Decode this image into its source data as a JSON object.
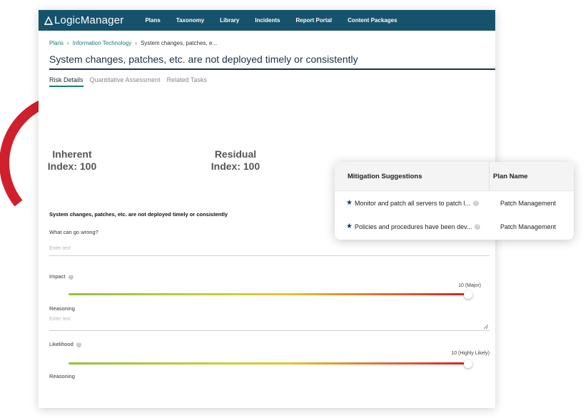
{
  "nav": {
    "logo": "LogicManager",
    "items": [
      "Plans",
      "Taxonomy",
      "Library",
      "Incidents",
      "Report Portal",
      "Content Packages"
    ]
  },
  "breadcrumb": [
    "Plans",
    "Information Technology",
    "System changes, patches, e..."
  ],
  "page_title": "System changes, patches, etc. are not deployed timely or consistently",
  "tabs": [
    {
      "label": "Risk Details",
      "active": true
    },
    {
      "label": "Quantitative Assessment",
      "active": false
    },
    {
      "label": "Related Tasks",
      "active": false
    }
  ],
  "gauges": [
    {
      "line1": "Inherent",
      "line2": "Index: 100"
    },
    {
      "line1": "Residual",
      "line2": "Index: 100"
    }
  ],
  "form": {
    "risk_statement": "System changes, patches, etc. are not deployed timely or consistently",
    "what_can_go_wrong_label": "What can go wrong?",
    "what_can_go_wrong_placeholder": "Enter text",
    "impact_label": "Impact",
    "impact_value_label": "10 (Major)",
    "impact_level": 1.0,
    "reasoning_label_1": "Reasoning",
    "reasoning_placeholder_1": "Enter text",
    "likelihood_label": "Likelihood",
    "likelihood_value_label": "10 (Highly Likely)",
    "likelihood_level": 1.0,
    "reasoning_label_2": "Reasoning"
  },
  "mitigation": {
    "col1_header": "Mitigation Suggestions",
    "col2_header": "Plan Name",
    "rows": [
      {
        "suggestion": "Monitor and patch all servers to patch l...",
        "plan": "Patch Management"
      },
      {
        "suggestion": "Policies and procedures have been dev...",
        "plan": "Patch Management"
      }
    ]
  },
  "colors": {
    "nav_bg": "#17526c",
    "gauge_red": "#d0202d",
    "accent_teal": "#1a7a7a",
    "title_navy": "#1c3148"
  }
}
